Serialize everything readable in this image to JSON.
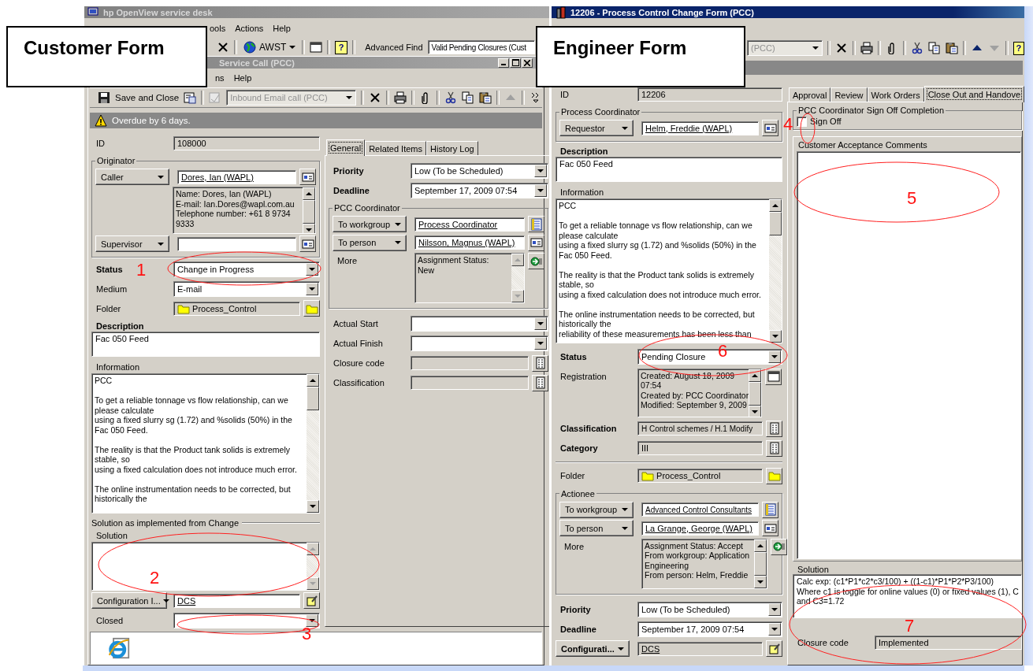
{
  "callouts": [
    "Customer Form",
    "Engineer Form"
  ],
  "markers": [
    "1",
    "2",
    "3",
    "4",
    "5",
    "6",
    "7"
  ],
  "customer": {
    "app_title": "hp OpenView service desk",
    "app_menu": [
      "ools",
      "Actions",
      "Help"
    ],
    "app_toolbar": {
      "profile": "AWST",
      "help": "?",
      "find_label": "Advanced Find",
      "find_value": "Valid Pending Closures (Cust"
    },
    "title": "Service Call (PCC)",
    "menu": [
      "ns",
      "Help"
    ],
    "save_label": "Save and Close",
    "template": "Inbound Email call (PCC)",
    "alert": "Overdue by 6 days.",
    "id": {
      "label": "ID",
      "value": "108000"
    },
    "originator": {
      "title": "Originator",
      "caller": {
        "button": "Caller",
        "value": "Dores, Ian (WAPL)"
      },
      "details": "Name: Dores, Ian (WAPL)\nE-mail: Ian.Dores@wapl.com.au\nTelephone number: +61 8 9734\n9333",
      "supervisor": {
        "button": "Supervisor"
      }
    },
    "status": {
      "label": "Status",
      "value": "Change in Progress"
    },
    "medium": {
      "label": "Medium",
      "value": "E-mail"
    },
    "folder": {
      "label": "Folder",
      "value": "Process_Control"
    },
    "description": {
      "label": "Description",
      "value": "Fac 050 Feed"
    },
    "information": {
      "label": "Information",
      "paragraphs": [
        "PCC",
        "To get a reliable tonnage vs flow relationship, can we\nplease calculate\nusing a fixed slurry sg (1.72) and %solids (50%) in the\nFac 050 Feed.",
        "The reality is that the Product tank solids is extremely\nstable, so\nusing a fixed calculation does not introduce much error.",
        "The online instrumentation needs to be corrected, but\nhistorically the"
      ]
    },
    "solution_group": "Solution as implemented from Change",
    "solution": {
      "label": "Solution"
    },
    "config": {
      "button": "Configuration I...",
      "value": "DCS"
    },
    "closed": {
      "label": "Closed"
    },
    "tabs": [
      {
        "label": "General",
        "selected": true
      },
      {
        "label": "Related Items",
        "selected": false
      },
      {
        "label": "History Log",
        "selected": false
      }
    ],
    "priority": {
      "label": "Priority",
      "value": "Low (To be Scheduled)"
    },
    "deadline": {
      "label": "Deadline",
      "value": "September 17, 2009 07:54"
    },
    "coordinator": {
      "title": "PCC Coordinator",
      "workgroup": {
        "button": "To workgroup",
        "value": "Process Coordinator"
      },
      "person": {
        "button": "To person",
        "value": "Nilsson, Magnus (WAPL)"
      },
      "more": {
        "label": "More",
        "text": "Assignment Status:\nNew"
      }
    },
    "actual_start": {
      "label": "Actual Start"
    },
    "actual_finish": {
      "label": "Actual Finish"
    },
    "closure_code": {
      "label": "Closure code"
    },
    "classification": {
      "label": "Classification"
    }
  },
  "engineer": {
    "title": "12206 - Process Control Change Form (PCC)",
    "template": "(PCC)",
    "help": "?",
    "id": {
      "label": "ID",
      "value": "12206"
    },
    "coordinator": {
      "title": "Process Coordinator",
      "requestor": {
        "button": "Requestor",
        "value": "Helm, Freddie (WAPL)"
      }
    },
    "description": {
      "label": "Description",
      "value": "Fac 050 Feed"
    },
    "information": {
      "label": "Information",
      "paragraphs": [
        "PCC",
        "To get a reliable tonnage vs flow relationship, can we\nplease calculate\nusing a fixed slurry sg (1.72) and %solids (50%) in the\nFac 050 Feed.",
        "The reality is that the Product tank solids is extremely\nstable, so\nusing a fixed calculation does not introduce much error.",
        "The online instrumentation needs to be corrected, but\nhistorically the\nreliability of these measurements has been less than"
      ]
    },
    "status": {
      "label": "Status",
      "value": "Pending Closure"
    },
    "registration": {
      "label": "Registration",
      "text": "Created: August 18, 2009\n07:54\nCreated by: PCC Coordinator\nModified: September 9, 2009"
    },
    "classification": {
      "label": "Classification",
      "value": "H Control schemes / H.1 Modify"
    },
    "category": {
      "label": "Category",
      "value": "III"
    },
    "folder": {
      "label": "Folder",
      "value": "Process_Control"
    },
    "actionee": {
      "title": "Actionee",
      "workgroup": {
        "button": "To workgroup",
        "value": "Advanced Control Consultants"
      },
      "person": {
        "button": "To person",
        "value": "La Grange, George (WAPL)"
      },
      "more": {
        "label": "More",
        "text": "Assignment Status: Accept\nFrom workgroup: Application\nEngineering\nFrom person: Helm, Freddie"
      }
    },
    "priority": {
      "label": "Priority",
      "value": "Low (To be Scheduled)"
    },
    "deadline": {
      "label": "Deadline",
      "value": "September 17, 2009 07:54"
    },
    "config": {
      "button": "Configurati...",
      "value": "DCS"
    },
    "tabs": [
      {
        "label": "Approval",
        "selected": false
      },
      {
        "label": "Review",
        "selected": false
      },
      {
        "label": "Work Orders",
        "selected": false
      },
      {
        "label": "Close Out and Handove",
        "selected": true
      }
    ],
    "signoff": {
      "title": "PCC Coordinator Sign Off Completion",
      "label": "Sign Off",
      "checked": false
    },
    "comments": {
      "label": "Customer Acceptance Comments"
    },
    "solution": {
      "label": "Solution",
      "text": "Calc exp: (c1*P1*c2*c3/100) + ((1-c1)*P1*P2*P3/100)\nWhere c1 is toggle for online values (0) or fixed values (1), C\nand C3=1.72"
    },
    "closure_code": {
      "label": "Closure code",
      "value": "Implemented"
    }
  }
}
